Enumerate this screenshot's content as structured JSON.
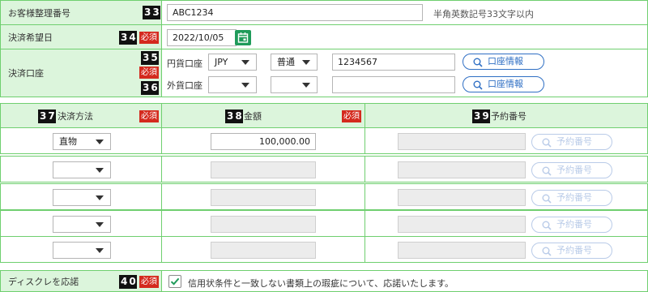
{
  "customer_ref": {
    "label": "お客様整理番号",
    "badge": "33",
    "value": "ABC1234",
    "hint": "半角英数記号33文字以内"
  },
  "settlement_date": {
    "label": "決済希望日",
    "badge": "34",
    "required": "必須",
    "value": "2022/10/05",
    "icon": "calendar-icon"
  },
  "settlement_account": {
    "label": "決済口座",
    "badge_top": "35",
    "required": "必須",
    "badge_bottom": "36",
    "yen": {
      "label": "円貨口座",
      "currency": "JPY",
      "account_type": "普通",
      "account_number": "1234567",
      "info_button": "口座情報"
    },
    "foreign": {
      "label": "外貨口座",
      "currency": "",
      "account_type": "",
      "account_number": "",
      "info_button": "口座情報"
    }
  },
  "table": {
    "columns": [
      {
        "label": "決済方法",
        "badge": "37",
        "required": "必須"
      },
      {
        "label": "金額",
        "badge": "38",
        "required": "必須"
      },
      {
        "label": "予約番号",
        "badge": "39",
        "required": ""
      }
    ],
    "rows": [
      {
        "method": "直物",
        "amount": "100,000.00",
        "reservation_number": "",
        "reservation_button": "予約番号"
      },
      {
        "method": "",
        "amount": "",
        "reservation_number": "",
        "reservation_button": "予約番号"
      },
      {
        "method": "",
        "amount": "",
        "reservation_number": "",
        "reservation_button": "予約番号"
      },
      {
        "method": "",
        "amount": "",
        "reservation_number": "",
        "reservation_button": "予約番号"
      },
      {
        "method": "",
        "amount": "",
        "reservation_number": "",
        "reservation_button": "予約番号"
      }
    ]
  },
  "disclosure": {
    "label": "ディスクレを応諾",
    "badge": "40",
    "required": "必須",
    "checked": true,
    "text": "信用状条件と一致しない書類上の瑕疵について、応諾いたします。"
  },
  "colors": {
    "label_bg": "#dcf5dc",
    "border": "#6fcf6f",
    "required_red": "#d42a1e",
    "link_blue": "#2f6fc4",
    "calendar_green": "#1f9b5a"
  }
}
